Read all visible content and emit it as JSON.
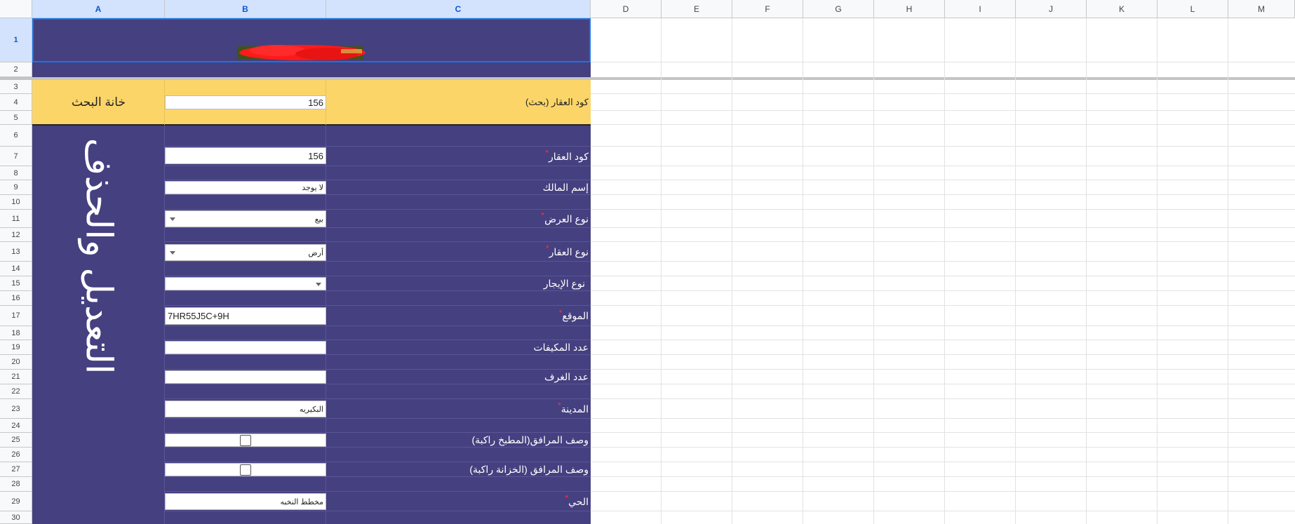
{
  "columns": [
    "A",
    "B",
    "C",
    "D",
    "E",
    "F",
    "G",
    "H",
    "I",
    "J",
    "K",
    "L",
    "M"
  ],
  "rows": [
    "1",
    "2",
    "3",
    "4",
    "5",
    "6",
    "7",
    "8",
    "9",
    "10",
    "11",
    "12",
    "13",
    "14",
    "15",
    "16",
    "17",
    "18",
    "19",
    "20",
    "21",
    "22",
    "23",
    "24",
    "25",
    "26",
    "27",
    "28",
    "29",
    "30"
  ],
  "search": {
    "title": "خانة البحث",
    "label": "كود العقار (بحث)",
    "value": "156"
  },
  "side_title": "التعديل والحذف",
  "form": {
    "code": {
      "label": "كود العقار",
      "value": "156",
      "required": true
    },
    "owner": {
      "label": "إسم المالك",
      "value": "لا يوجد",
      "required": false
    },
    "offer_type": {
      "label": "نوع العرض",
      "value": "بيع",
      "required": true
    },
    "property_type": {
      "label": "نوع العقار",
      "value": "أرض",
      "required": true
    },
    "rent_type": {
      "label": "نوع الإيجار",
      "value": "",
      "required": false
    },
    "location": {
      "label": "الموقع",
      "value": "7HR55J5C+9H",
      "required": true
    },
    "ac_count": {
      "label": "عدد المكيفات",
      "value": "",
      "required": false
    },
    "rooms": {
      "label": "عدد الغرف",
      "value": "",
      "required": false
    },
    "city": {
      "label": "المدينة",
      "value": "البكيريه",
      "required": true
    },
    "kitchen": {
      "label": "وصف المرافق(المطبخ راكبة)",
      "checked": false
    },
    "closet": {
      "label": "وصف المرافق (الخزانة راكبة)",
      "checked": false
    },
    "district": {
      "label": "الحي",
      "value": "مخطط النخبه",
      "required": true
    }
  },
  "required_marker": "*",
  "colors": {
    "header_purple": "#454080",
    "search_yellow": "#fcd569",
    "selection_blue": "#1a73e8"
  }
}
